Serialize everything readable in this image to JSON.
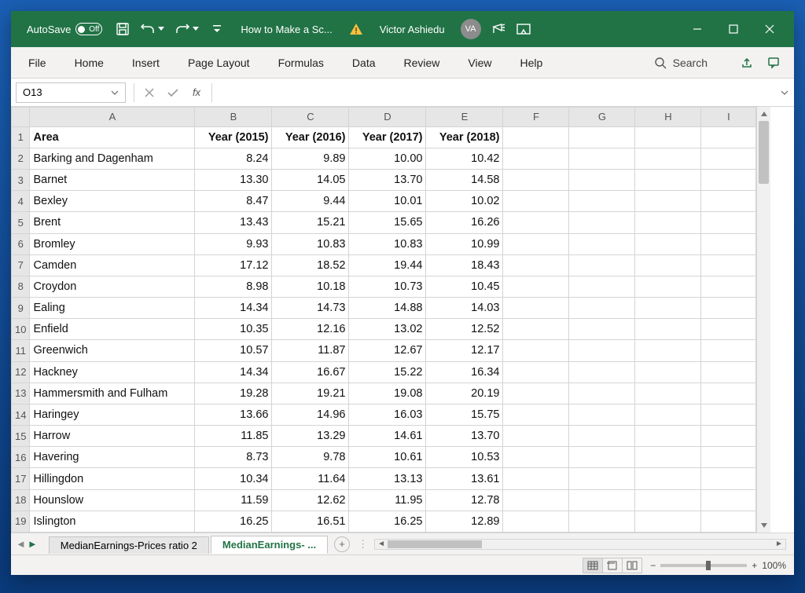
{
  "titlebar": {
    "autosave_label": "AutoSave",
    "autosave_state": "Off",
    "doc_title": "How to Make a Sc...",
    "user_name": "Victor Ashiedu",
    "user_initials": "VA"
  },
  "ribbon": {
    "tabs": [
      "File",
      "Home",
      "Insert",
      "Page Layout",
      "Formulas",
      "Data",
      "Review",
      "View",
      "Help"
    ],
    "search_label": "Search"
  },
  "formula_bar": {
    "name_box": "O13",
    "fx_label": "fx",
    "formula_value": ""
  },
  "grid": {
    "columns": [
      "A",
      "B",
      "C",
      "D",
      "E",
      "F",
      "G",
      "H",
      "I"
    ],
    "headers": [
      "Area",
      "Year (2015)",
      "Year (2016)",
      "Year (2017)",
      "Year (2018)"
    ],
    "rows": [
      {
        "n": 1,
        "area": "Area",
        "y2015": "Year (2015)",
        "y2016": "Year (2016)",
        "y2017": "Year (2017)",
        "y2018": "Year (2018)",
        "header": true
      },
      {
        "n": 2,
        "area": "Barking and Dagenham",
        "y2015": "8.24",
        "y2016": "9.89",
        "y2017": "10.00",
        "y2018": "10.42"
      },
      {
        "n": 3,
        "area": "Barnet",
        "y2015": "13.30",
        "y2016": "14.05",
        "y2017": "13.70",
        "y2018": "14.58"
      },
      {
        "n": 4,
        "area": "Bexley",
        "y2015": "8.47",
        "y2016": "9.44",
        "y2017": "10.01",
        "y2018": "10.02"
      },
      {
        "n": 5,
        "area": "Brent",
        "y2015": "13.43",
        "y2016": "15.21",
        "y2017": "15.65",
        "y2018": "16.26"
      },
      {
        "n": 6,
        "area": "Bromley",
        "y2015": "9.93",
        "y2016": "10.83",
        "y2017": "10.83",
        "y2018": "10.99"
      },
      {
        "n": 7,
        "area": "Camden",
        "y2015": "17.12",
        "y2016": "18.52",
        "y2017": "19.44",
        "y2018": "18.43"
      },
      {
        "n": 8,
        "area": "Croydon",
        "y2015": "8.98",
        "y2016": "10.18",
        "y2017": "10.73",
        "y2018": "10.45"
      },
      {
        "n": 9,
        "area": "Ealing",
        "y2015": "14.34",
        "y2016": "14.73",
        "y2017": "14.88",
        "y2018": "14.03"
      },
      {
        "n": 10,
        "area": "Enfield",
        "y2015": "10.35",
        "y2016": "12.16",
        "y2017": "13.02",
        "y2018": "12.52"
      },
      {
        "n": 11,
        "area": "Greenwich",
        "y2015": "10.57",
        "y2016": "11.87",
        "y2017": "12.67",
        "y2018": "12.17"
      },
      {
        "n": 12,
        "area": "Hackney",
        "y2015": "14.34",
        "y2016": "16.67",
        "y2017": "15.22",
        "y2018": "16.34"
      },
      {
        "n": 13,
        "area": "Hammersmith and Fulham",
        "y2015": "19.28",
        "y2016": "19.21",
        "y2017": "19.08",
        "y2018": "20.19"
      },
      {
        "n": 14,
        "area": "Haringey",
        "y2015": "13.66",
        "y2016": "14.96",
        "y2017": "16.03",
        "y2018": "15.75"
      },
      {
        "n": 15,
        "area": "Harrow",
        "y2015": "11.85",
        "y2016": "13.29",
        "y2017": "14.61",
        "y2018": "13.70"
      },
      {
        "n": 16,
        "area": "Havering",
        "y2015": "8.73",
        "y2016": "9.78",
        "y2017": "10.61",
        "y2018": "10.53"
      },
      {
        "n": 17,
        "area": "Hillingdon",
        "y2015": "10.34",
        "y2016": "11.64",
        "y2017": "13.13",
        "y2018": "13.61"
      },
      {
        "n": 18,
        "area": "Hounslow",
        "y2015": "11.59",
        "y2016": "12.62",
        "y2017": "11.95",
        "y2018": "12.78"
      },
      {
        "n": 19,
        "area": "Islington",
        "y2015": "16.25",
        "y2016": "16.51",
        "y2017": "16.25",
        "y2018": "12.89"
      }
    ]
  },
  "sheets": {
    "inactive": "MedianEarnings-Prices ratio 2",
    "active": "MedianEarnings- ..."
  },
  "status": {
    "zoom": "100%"
  }
}
